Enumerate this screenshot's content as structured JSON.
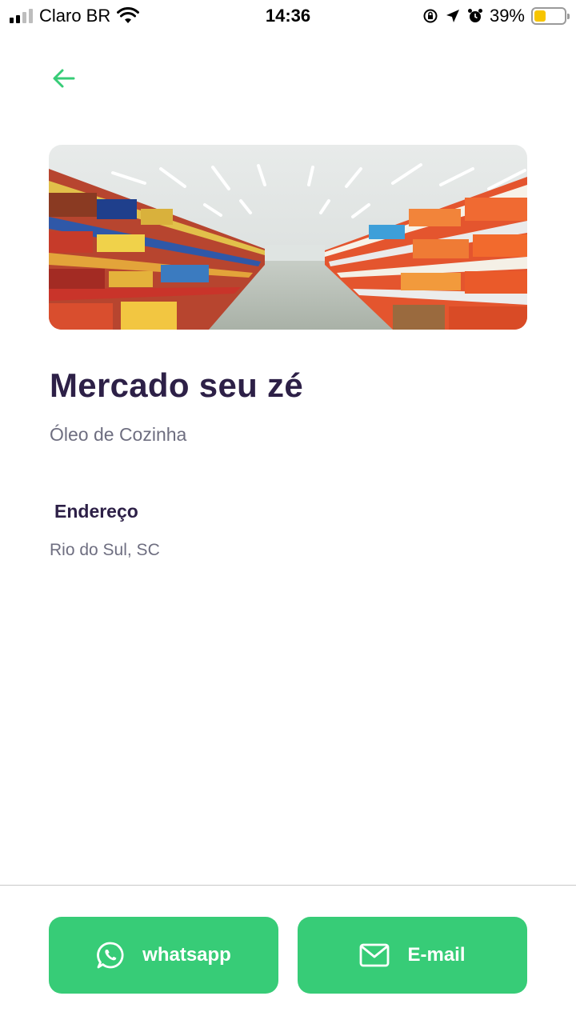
{
  "status_bar": {
    "carrier": "Claro BR",
    "time": "14:36",
    "battery_percent": "39%",
    "battery_level": 0.39
  },
  "store": {
    "name": "Mercado seu zé",
    "category": "Óleo de Cozinha"
  },
  "address_section": {
    "label": "Endereço",
    "value": "Rio do Sul, SC"
  },
  "actions": {
    "whatsapp_label": "whatsapp",
    "email_label": "E-mail"
  },
  "colors": {
    "accent": "#37cc77",
    "title": "#2d2047",
    "muted": "#6e6e80"
  },
  "icons": {
    "back": "arrow-left-icon",
    "whatsapp": "whatsapp-icon",
    "email": "mail-icon"
  }
}
